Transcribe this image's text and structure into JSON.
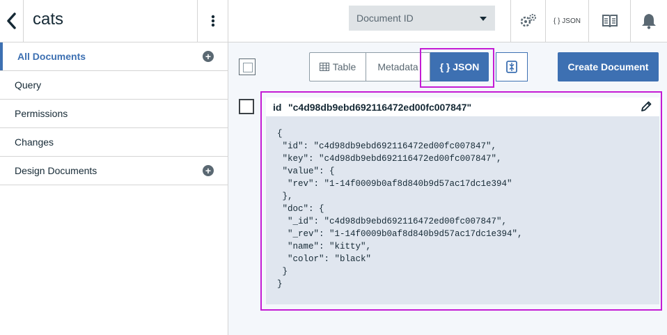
{
  "sidebar": {
    "back_icon": "chevron-left-icon",
    "title": "cats",
    "menu_icon": "kebab-icon",
    "items": [
      {
        "label": "All Documents",
        "active": true,
        "add_icon": "plus-circle-icon"
      },
      {
        "label": "Query"
      },
      {
        "label": "Permissions"
      },
      {
        "label": "Changes"
      },
      {
        "label": "Design Documents",
        "add_icon": "plus-circle-icon"
      }
    ]
  },
  "topbar": {
    "select_value": "Document ID",
    "settings_icon": "gears-icon",
    "json_label": "{ } JSON",
    "docs_icon": "book-icon",
    "notifications_icon": "bell-icon"
  },
  "toolbar": {
    "views": [
      {
        "label": "Table",
        "icon": "table-icon"
      },
      {
        "label": "Metadata"
      },
      {
        "label": "{ } JSON",
        "selected": true
      }
    ],
    "collapse_icon": "collapse-expand-icon",
    "create_label": "Create Document"
  },
  "document": {
    "id_key": "id",
    "id_value": "\"c4d98db9ebd692116472ed00fc007847\"",
    "edit_icon": "pencil-icon",
    "json": "{\n \"id\": \"c4d98db9ebd692116472ed00fc007847\",\n \"key\": \"c4d98db9ebd692116472ed00fc007847\",\n \"value\": {\n  \"rev\": \"1-14f0009b0af8d840b9d57ac17dc1e394\"\n },\n \"doc\": {\n  \"_id\": \"c4d98db9ebd692116472ed00fc007847\",\n  \"_rev\": \"1-14f0009b0af8d840b9d57ac17dc1e394\",\n  \"name\": \"kitty\",\n  \"color\": \"black\"\n }\n}"
  },
  "colors": {
    "accent": "#3d70b2",
    "highlight": "#c41bd4",
    "json_bg": "#e0e6ef"
  }
}
